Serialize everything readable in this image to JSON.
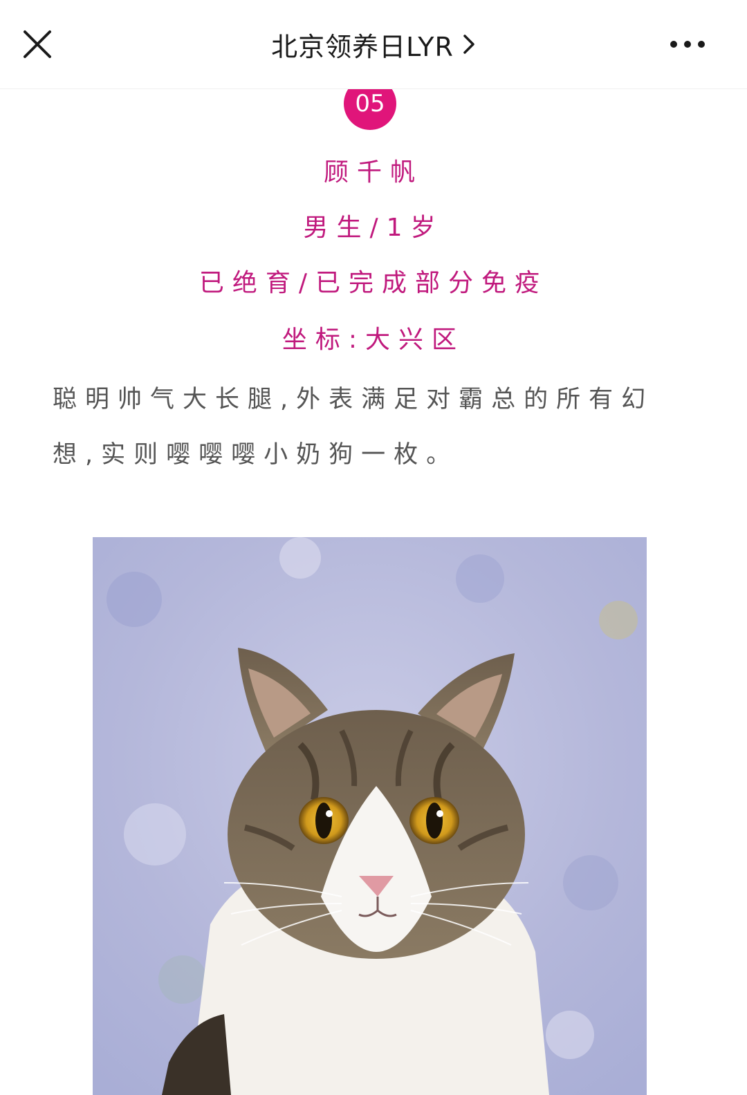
{
  "header": {
    "title": "北京领养日LYR"
  },
  "post": {
    "number": "05",
    "name": "顾千帆",
    "gender_age": "男生/1岁",
    "medical": "已绝育/已完成部分免疫",
    "location": "坐标:大兴区",
    "description": "聪明帅气大长腿,外表满足对霸总的所有幻想,实则嘤嘤嘤小奶狗一枚。"
  },
  "icons": {
    "close": "close-icon",
    "chevron": "chevron-right-icon",
    "more": "more-icon"
  },
  "colors": {
    "accent": "#e0157a",
    "pink_text": "#c0197d",
    "body_text": "#555555"
  }
}
